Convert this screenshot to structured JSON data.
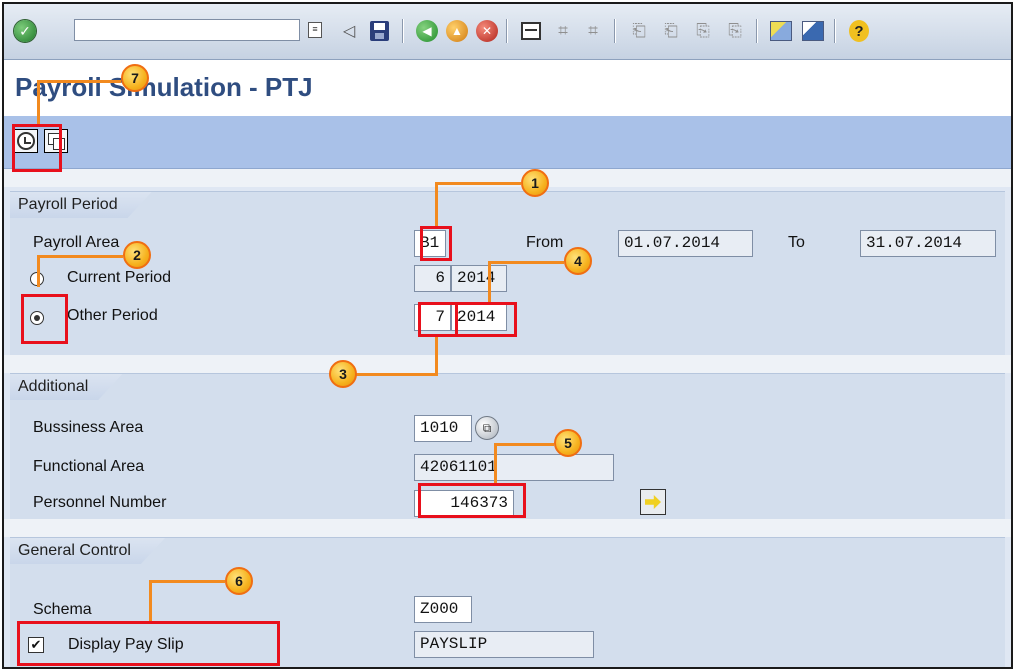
{
  "toolbar": {
    "enter_icon": "green-check-icon",
    "command_field": "",
    "icons": [
      "back-arrow-icon",
      "save-icon",
      "back-icon",
      "exit-icon",
      "cancel-icon",
      "print-icon",
      "find-icon",
      "find-next-icon",
      "first-page-icon",
      "previous-page-icon",
      "next-page-icon",
      "last-page-icon",
      "create-session-icon",
      "shortcut-icon",
      "help-icon"
    ]
  },
  "title": "Payroll Simulation - PTJ",
  "app_toolbar": {
    "execute_icon": "execute-clock-icon",
    "multiple_selection_icon": "multiple-selection-icon"
  },
  "payroll_period": {
    "heading": "Payroll Period",
    "payroll_area_label": "Payroll Area",
    "payroll_area_value": "B1",
    "from_label": "From",
    "from_value": "01.07.2014",
    "to_label": "To",
    "to_value": "31.07.2014",
    "current_period_label": "Current Period",
    "current_period_num": "6",
    "current_period_year": "2014",
    "other_period_label": "Other Period",
    "other_period_num": "7",
    "other_period_year": "2014",
    "selected_option": "Other Period"
  },
  "additional": {
    "heading": "Additional",
    "business_area_label": "Bussiness Area",
    "business_area_value": "1010",
    "functional_area_label": "Functional Area",
    "functional_area_value": "42061101",
    "personnel_number_label": "Personnel Number",
    "personnel_number_value": "146373"
  },
  "general_control": {
    "heading": "General Control",
    "schema_label": "Schema",
    "schema_value": "Z000",
    "display_pay_slip_label": "Display Pay Slip",
    "display_pay_slip_checked": true,
    "pay_slip_value": "PAYSLIP",
    "checkbox_mark": "✔"
  },
  "annotations": {
    "markers": [
      "1",
      "2",
      "3",
      "4",
      "5",
      "6",
      "7"
    ],
    "highlight_color": "#e8101c",
    "callout_color": "#f28a1f"
  }
}
